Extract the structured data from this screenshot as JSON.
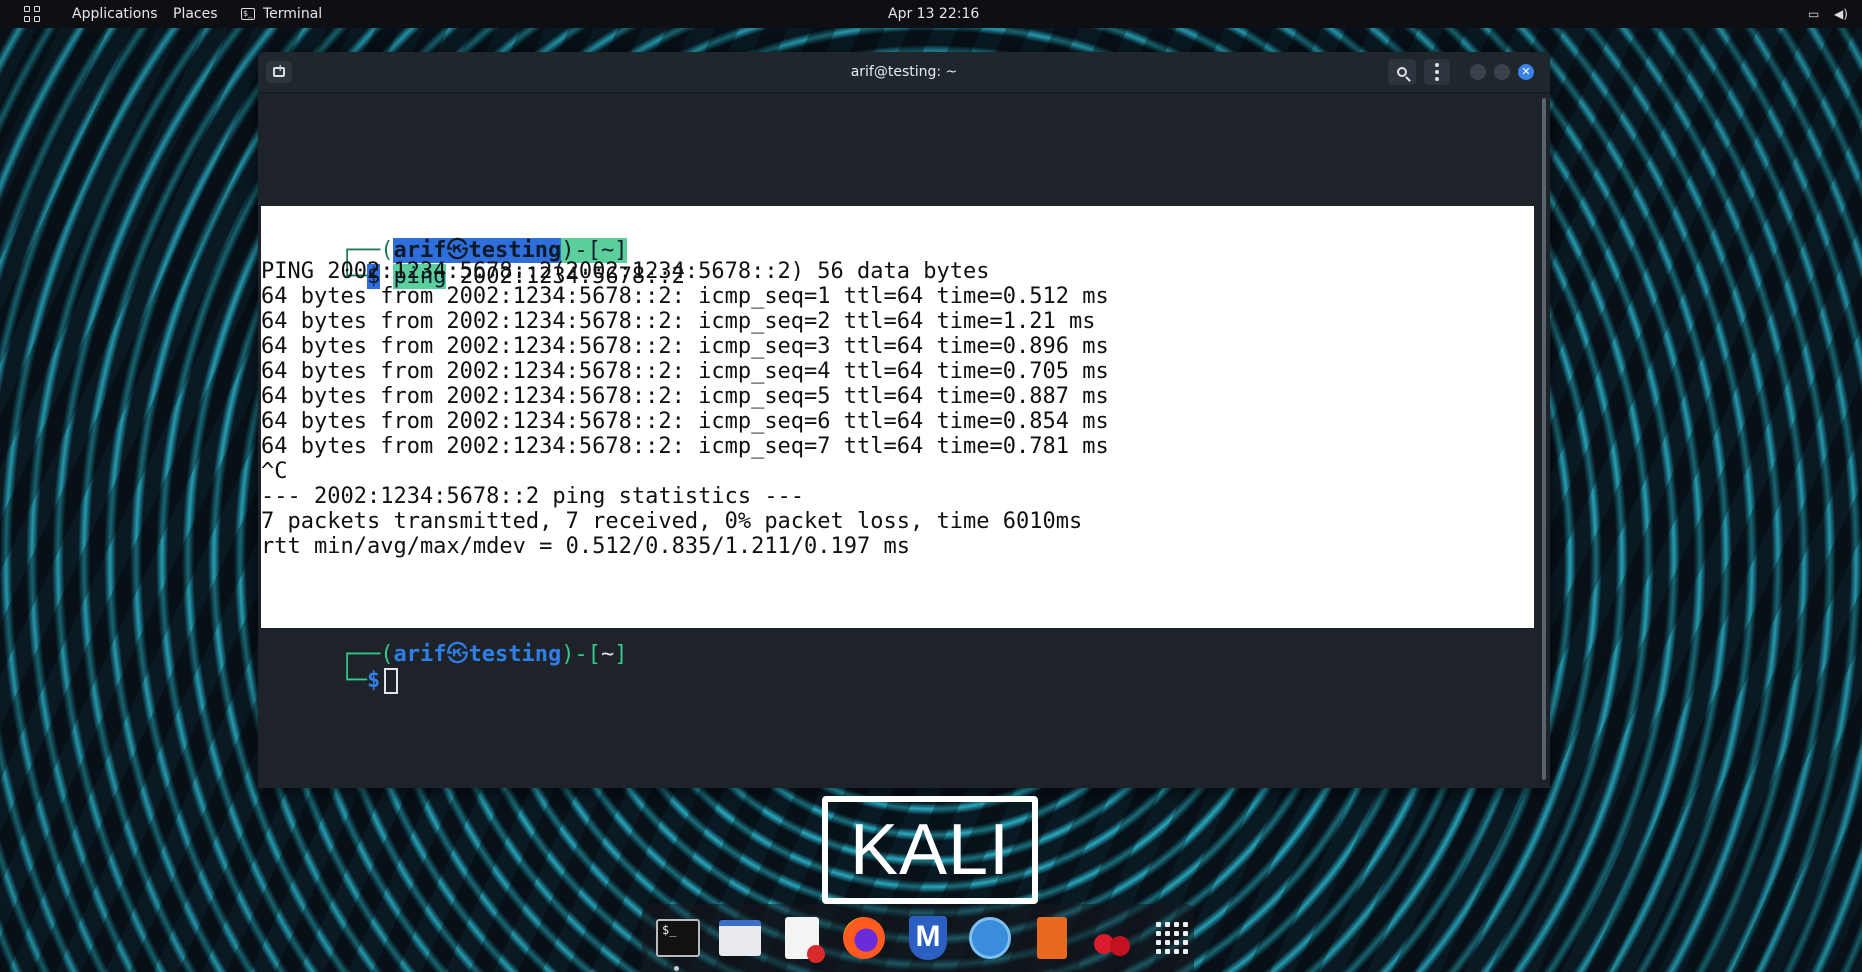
{
  "topbar": {
    "applications_label": "Applications",
    "places_label": "Places",
    "terminal_label": "Terminal",
    "clock": "Apr 13  22:16"
  },
  "window": {
    "title": "arif@testing: ~"
  },
  "terminal": {
    "prompt1": {
      "frame_open": "┌──(",
      "user": "arif",
      "at": "㉿",
      "host": "testing",
      "frame_mid": ")-[",
      "path": "~",
      "frame_close": "]",
      "line2_frame": "└─",
      "dollar": "$",
      "command": "ping",
      "args": " 2002:1234:5678::2"
    },
    "output": [
      "PING 2002:1234:5678::2(2002:1234:5678::2) 56 data bytes",
      "64 bytes from 2002:1234:5678::2: icmp_seq=1 ttl=64 time=0.512 ms",
      "64 bytes from 2002:1234:5678::2: icmp_seq=2 ttl=64 time=1.21 ms",
      "64 bytes from 2002:1234:5678::2: icmp_seq=3 ttl=64 time=0.896 ms",
      "64 bytes from 2002:1234:5678::2: icmp_seq=4 ttl=64 time=0.705 ms",
      "64 bytes from 2002:1234:5678::2: icmp_seq=5 ttl=64 time=0.887 ms",
      "64 bytes from 2002:1234:5678::2: icmp_seq=6 ttl=64 time=0.854 ms",
      "64 bytes from 2002:1234:5678::2: icmp_seq=7 ttl=64 time=0.781 ms",
      "^C",
      "--- 2002:1234:5678::2 ping statistics ---",
      "7 packets transmitted, 7 received, 0% packet loss, time 6010ms",
      "rtt min/avg/max/mdev = 0.512/0.835/1.211/0.197 ms"
    ],
    "prompt2": {
      "frame_open": "┌──(",
      "user": "arif",
      "at": "㉿",
      "host": "testing",
      "frame_mid": ")-[",
      "path": "~",
      "frame_close": "]",
      "line2_frame": "└─",
      "dollar": "$"
    }
  },
  "desktop": {
    "logo_text": "KALI"
  },
  "dock": {
    "terminal_glyph": "$_"
  },
  "icons": [
    "apps-grid-icon",
    "terminal-icon",
    "display-icon",
    "volume-icon",
    "new-tab-icon",
    "search-icon",
    "menu-icon",
    "minimize-icon",
    "maximize-icon",
    "close-icon",
    "files-icon",
    "text-editor-icon",
    "firefox-icon",
    "metasploit-icon",
    "wireshark-icon",
    "burpsuite-icon",
    "cherrytree-icon",
    "show-apps-icon"
  ],
  "colors": {
    "prompt_frame": "#34c88a",
    "prompt_user": "#2f7fe8",
    "close_button": "#3b82e6",
    "selection": "#ffffff"
  }
}
